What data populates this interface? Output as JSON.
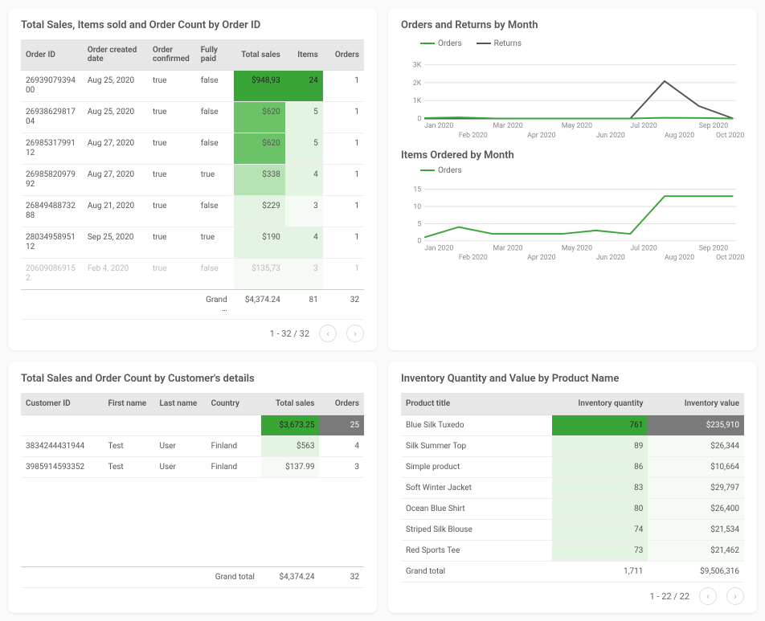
{
  "sales_table": {
    "title": "Total Sales, Items sold and Order Count by Order ID",
    "headers": [
      "Order ID",
      "Order created date",
      "Order confirmed",
      "Fully paid",
      "Total sales",
      "Items",
      "Orders"
    ],
    "rows": [
      {
        "id": "2693907939400",
        "date": "Aug 25, 2020",
        "conf": "true",
        "paid": "false",
        "sales": "$948,93",
        "items": "24",
        "orders": "1",
        "h": 4,
        "ih": 4
      },
      {
        "id": "2693862981704",
        "date": "Aug 25, 2020",
        "conf": "true",
        "paid": "false",
        "sales": "$620",
        "items": "5",
        "orders": "1",
        "h": 3,
        "ih": 1
      },
      {
        "id": "2698531799112",
        "date": "Aug 27, 2020",
        "conf": "true",
        "paid": "false",
        "sales": "$620",
        "items": "5",
        "orders": "1",
        "h": 3,
        "ih": 1
      },
      {
        "id": "2698582097992",
        "date": "Aug 27, 2020",
        "conf": "true",
        "paid": "true",
        "sales": "$338",
        "items": "4",
        "orders": "1",
        "h": 2,
        "ih": 1
      },
      {
        "id": "2684948873288",
        "date": "Aug 21, 2020",
        "conf": "true",
        "paid": "false",
        "sales": "$229",
        "items": "3",
        "orders": "1",
        "h": 1,
        "ih": 0
      },
      {
        "id": "2803495895112",
        "date": "Sep 25, 2020",
        "conf": "true",
        "paid": "true",
        "sales": "$190",
        "items": "4",
        "orders": "1",
        "h": 1,
        "ih": 1
      }
    ],
    "faded": {
      "id": "206090869152",
      "date": "Feb 4, 2020",
      "conf": "true",
      "paid": "false",
      "sales": "$135,73",
      "items": "3",
      "orders": "1"
    },
    "grand": {
      "label": "Grand …",
      "sales": "$4,374.24",
      "items": "81",
      "orders": "32"
    },
    "pager": "1 - 32 / 32"
  },
  "charts_card": {
    "title1": "Orders and Returns by Month",
    "legend1": [
      "Orders",
      "Returns"
    ],
    "title2": "Items Ordered by Month",
    "legend2": [
      "Orders"
    ]
  },
  "customers": {
    "title": "Total Sales and Order Count by Customer's details",
    "headers": [
      "Customer ID",
      "First name",
      "Last name",
      "Country",
      "Total sales",
      "Orders"
    ],
    "summary": {
      "sales": "$3,673.25",
      "orders": "25"
    },
    "rows": [
      {
        "id": "3834244431944",
        "first": "Test",
        "last": "User",
        "country": "Finland",
        "sales": "$563",
        "orders": "4"
      },
      {
        "id": "3985914593352",
        "first": "Test",
        "last": "User",
        "country": "Finland",
        "sales": "$137.99",
        "orders": "3"
      }
    ],
    "grand": {
      "label": "Grand total",
      "sales": "$4,374.24",
      "orders": "32"
    }
  },
  "inventory": {
    "title": "Inventory Quantity and Value by Product Name",
    "headers": [
      "Product title",
      "Inventory quantity",
      "Inventory value"
    ],
    "rows": [
      {
        "title": "Blue Silk Tuxedo",
        "qty": "761",
        "val": "$235,910",
        "h": 4,
        "vh": "g"
      },
      {
        "title": "Silk Summer Top",
        "qty": "89",
        "val": "$26,344",
        "h": 1,
        "vh": 0
      },
      {
        "title": "Simple product",
        "qty": "86",
        "val": "$10,664",
        "h": 1,
        "vh": 0
      },
      {
        "title": "Soft Winter Jacket",
        "qty": "83",
        "val": "$29,797",
        "h": 1,
        "vh": 0
      },
      {
        "title": "Ocean Blue Shirt",
        "qty": "80",
        "val": "$26,400",
        "h": 1,
        "vh": 0
      },
      {
        "title": "Striped Silk Blouse",
        "qty": "74",
        "val": "$21,534",
        "h": 1,
        "vh": 0
      },
      {
        "title": "Red Sports Tee",
        "qty": "73",
        "val": "$21,462",
        "h": 1,
        "vh": 0
      }
    ],
    "grand": {
      "label": "Grand total",
      "qty": "1,711",
      "val": "$9,506,316"
    },
    "pager": "1 - 22 / 22"
  },
  "chart_data": [
    {
      "type": "line",
      "title": "Orders and Returns by Month",
      "xlabel": "",
      "ylabel": "",
      "ylim": [
        0,
        3000
      ],
      "x": [
        "Jan 2020",
        "Feb 2020",
        "Mar 2020",
        "Apr 2020",
        "May 2020",
        "Jun 2020",
        "Jul 2020",
        "Aug 2020",
        "Sep 2020",
        "Oct 2020"
      ],
      "series": [
        {
          "name": "Orders",
          "values": [
            20,
            60,
            10,
            5,
            5,
            5,
            5,
            40,
            30,
            0
          ]
        },
        {
          "name": "Returns",
          "values": [
            0,
            0,
            0,
            0,
            0,
            0,
            0,
            2100,
            700,
            0
          ]
        }
      ]
    },
    {
      "type": "line",
      "title": "Items Ordered by Month",
      "xlabel": "",
      "ylabel": "",
      "ylim": [
        0,
        15
      ],
      "x": [
        "Jan 2020",
        "Feb 2020",
        "Mar 2020",
        "Apr 2020",
        "May 2020",
        "Jun 2020",
        "Jul 2020",
        "Aug 2020",
        "Sep 2020",
        "Oct 2020"
      ],
      "series": [
        {
          "name": "Orders",
          "values": [
            1,
            4,
            2,
            2,
            2,
            3,
            2,
            13,
            13,
            13
          ]
        }
      ]
    }
  ]
}
